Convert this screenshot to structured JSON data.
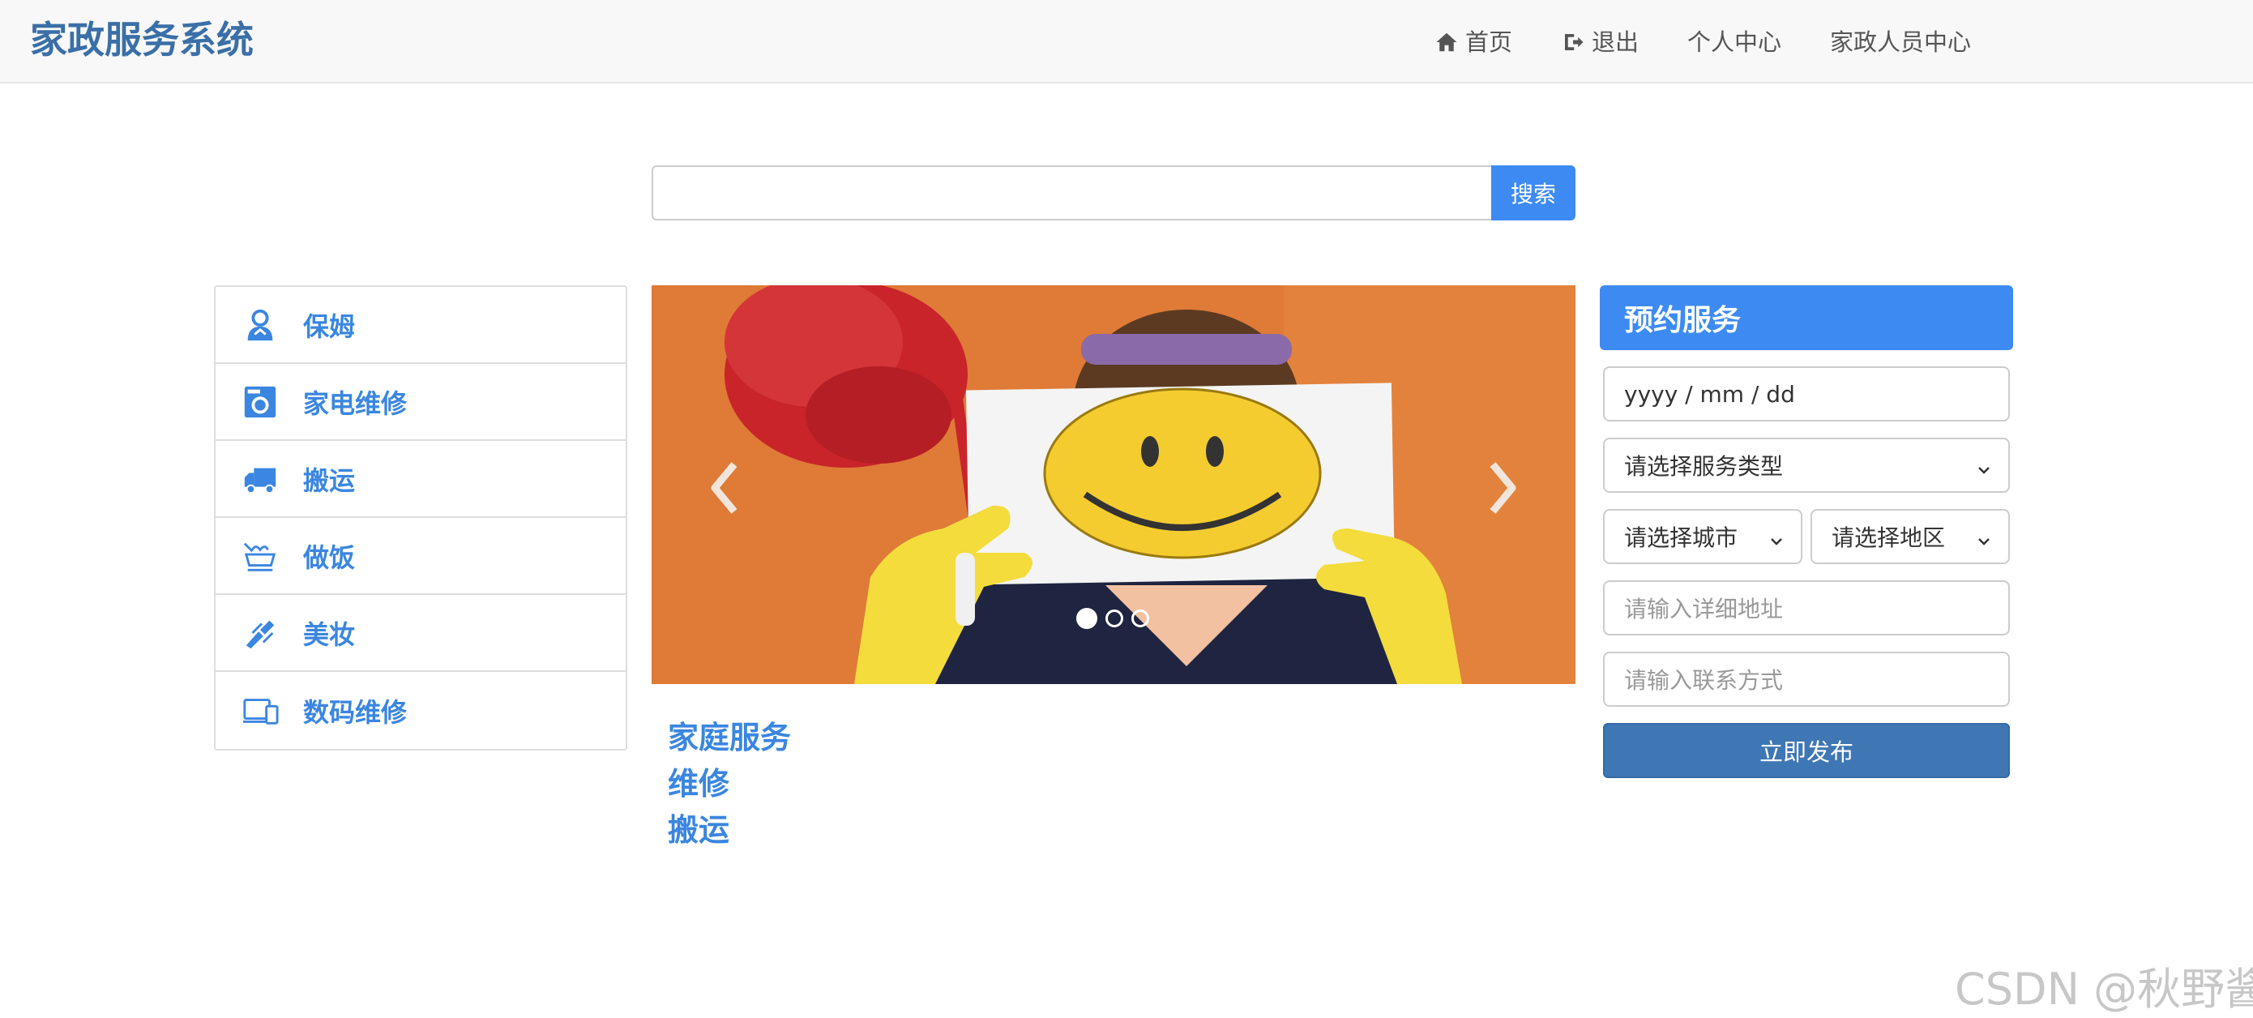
{
  "brand": "家政服务系统",
  "nav": [
    {
      "label": "首页",
      "icon": "home-icon"
    },
    {
      "label": "退出",
      "icon": "logout-icon"
    },
    {
      "label": "个人中心",
      "icon": ""
    },
    {
      "label": "家政人员中心",
      "icon": ""
    }
  ],
  "search": {
    "value": "",
    "placeholder": "",
    "button_label": "搜索"
  },
  "sidebar": {
    "items": [
      {
        "label": "保姆",
        "icon": "nanny-icon"
      },
      {
        "label": "家电维修",
        "icon": "washing-machine-icon"
      },
      {
        "label": "搬运",
        "icon": "truck-icon"
      },
      {
        "label": "做饭",
        "icon": "cooking-icon"
      },
      {
        "label": "美妆",
        "icon": "makeup-brush-icon"
      },
      {
        "label": "数码维修",
        "icon": "devices-icon"
      }
    ]
  },
  "carousel": {
    "slide_count": 3,
    "active_index": 0,
    "prev_icon": "chevron-left-icon",
    "next_icon": "chevron-right-icon"
  },
  "categories": [
    "家庭服务",
    "维修",
    "搬运"
  ],
  "booking": {
    "title": "预约服务",
    "date_placeholder": "yyyy / mm / dd",
    "service_type": "请选择服务类型",
    "city": "请选择城市",
    "district": "请选择地区",
    "address_placeholder": "请输入详细地址",
    "contact_placeholder": "请输入联系方式",
    "submit_label": "立即发布"
  },
  "watermark": "CSDN @秋野酱",
  "colors": {
    "brand": "#3a6fa8",
    "accent": "#3d8bf2",
    "link": "#3a86e0",
    "submit": "#3f77b5"
  }
}
